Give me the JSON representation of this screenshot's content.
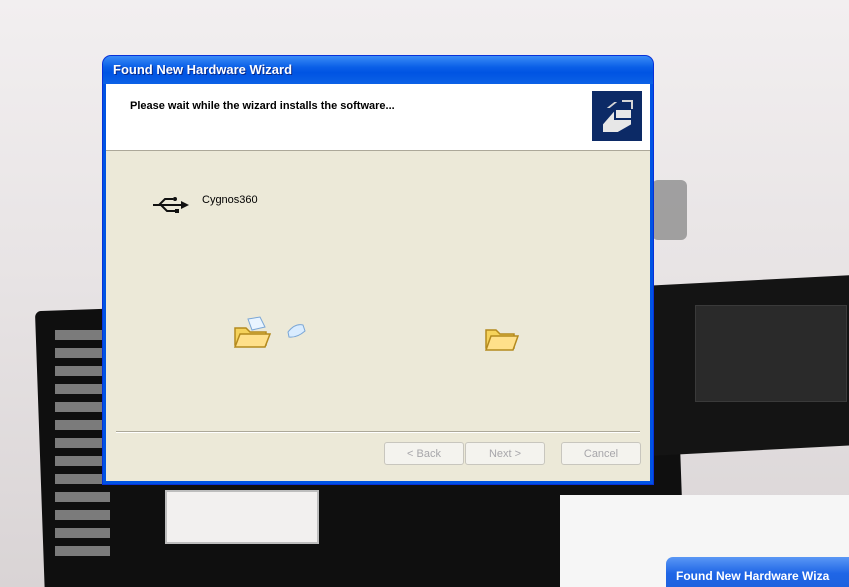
{
  "background": {
    "colors": {
      "surface": "#e9e5e6",
      "board": "#0f0f0f"
    }
  },
  "dialog": {
    "title": "Found New Hardware Wizard",
    "header_text": "Please wait while the wizard installs the software...",
    "device": {
      "icon": "usb-icon",
      "label": "Cygnos360"
    },
    "animation": {
      "source_icon": "folder-open-icon",
      "paper_icon": "paper-icon",
      "target_icon": "folder-icon"
    },
    "buttons": {
      "back": "< Back",
      "next": "Next >",
      "cancel": "Cancel"
    },
    "colors": {
      "title_bar": "#0054e3",
      "client_bg": "#ece9d8",
      "header_bg": "#ffffff",
      "disabled_text": "#a7a6aa"
    }
  },
  "second_window": {
    "title": "Found New Hardware Wiza"
  }
}
